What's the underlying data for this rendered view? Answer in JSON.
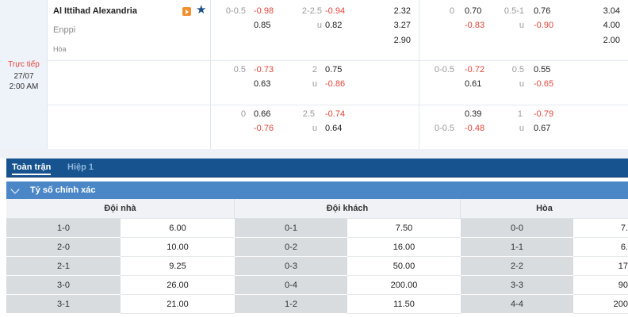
{
  "match": {
    "status": "Trực tiếp",
    "date": "27/07",
    "time": "2:00 AM",
    "home_team": "Al Ittihad Alexandria",
    "away_team": "Enppi",
    "draw_label": "Hòa"
  },
  "odds_rows": [
    {
      "ft_hdp": {
        "line": "0-0.5",
        "home": "-0.98",
        "away": "0.85"
      },
      "ft_ou": {
        "line": "2-2.5",
        "over": "-0.94",
        "u_label": "u",
        "under": "0.82"
      },
      "ft_1x2": {
        "home": "2.32",
        "away": "3.27",
        "draw": "2.90"
      },
      "h1_hdp": {
        "line": "0",
        "home": "0.70",
        "away": "-0.83"
      },
      "h1_ou": {
        "line": "0.5-1",
        "over": "0.76",
        "u_label": "u",
        "under": "-0.90"
      },
      "h1_1x2": {
        "home": "3.04",
        "away": "4.00",
        "draw": "2.00"
      }
    },
    {
      "ft_hdp": {
        "line": "0.5",
        "home": "-0.73",
        "away": "0.63"
      },
      "ft_ou": {
        "line": "2",
        "over": "0.75",
        "u_label": "u",
        "under": "-0.86"
      },
      "h1_hdp": {
        "line": "0-0.5",
        "home": "-0.72",
        "away": "0.61"
      },
      "h1_ou": {
        "line": "0.5",
        "over": "0.55",
        "u_label": "u",
        "under": "-0.65"
      }
    },
    {
      "ft_hdp": {
        "line": "0",
        "home": "0.66",
        "away": "-0.76"
      },
      "ft_ou": {
        "line": "2.5",
        "over": "-0.74",
        "u_label": "u",
        "under": "0.64"
      },
      "h1_hdp": {
        "line_home": "",
        "home": "0.39",
        "line_away": "0-0.5",
        "away": "-0.48"
      },
      "h1_ou": {
        "line": "1",
        "over": "-0.79",
        "u_label": "u",
        "under": "0.67"
      }
    }
  ],
  "tabs": {
    "full_match": "Toàn trận",
    "half1": "Hiệp 1"
  },
  "section": {
    "title": "Tỷ số chính xác"
  },
  "score_table": {
    "headers": {
      "home": "Đội nhà",
      "away": "Đội khách",
      "draw": "Hòa"
    },
    "home": [
      {
        "score": "1-0",
        "odd": "6.00"
      },
      {
        "score": "2-0",
        "odd": "10.00"
      },
      {
        "score": "2-1",
        "odd": "9.25"
      },
      {
        "score": "3-0",
        "odd": "26.00"
      },
      {
        "score": "3-1",
        "odd": "21.00"
      }
    ],
    "away": [
      {
        "score": "0-1",
        "odd": "7.50"
      },
      {
        "score": "0-2",
        "odd": "16.00"
      },
      {
        "score": "0-3",
        "odd": "50.00"
      },
      {
        "score": "0-4",
        "odd": "200.00"
      },
      {
        "score": "1-2",
        "odd": "11.50"
      }
    ],
    "draw": [
      {
        "score": "0-0",
        "odd": "7."
      },
      {
        "score": "1-1",
        "odd": "6."
      },
      {
        "score": "2-2",
        "odd": "17"
      },
      {
        "score": "3-3",
        "odd": "90"
      },
      {
        "score": "4-4",
        "odd": "200"
      }
    ]
  }
}
